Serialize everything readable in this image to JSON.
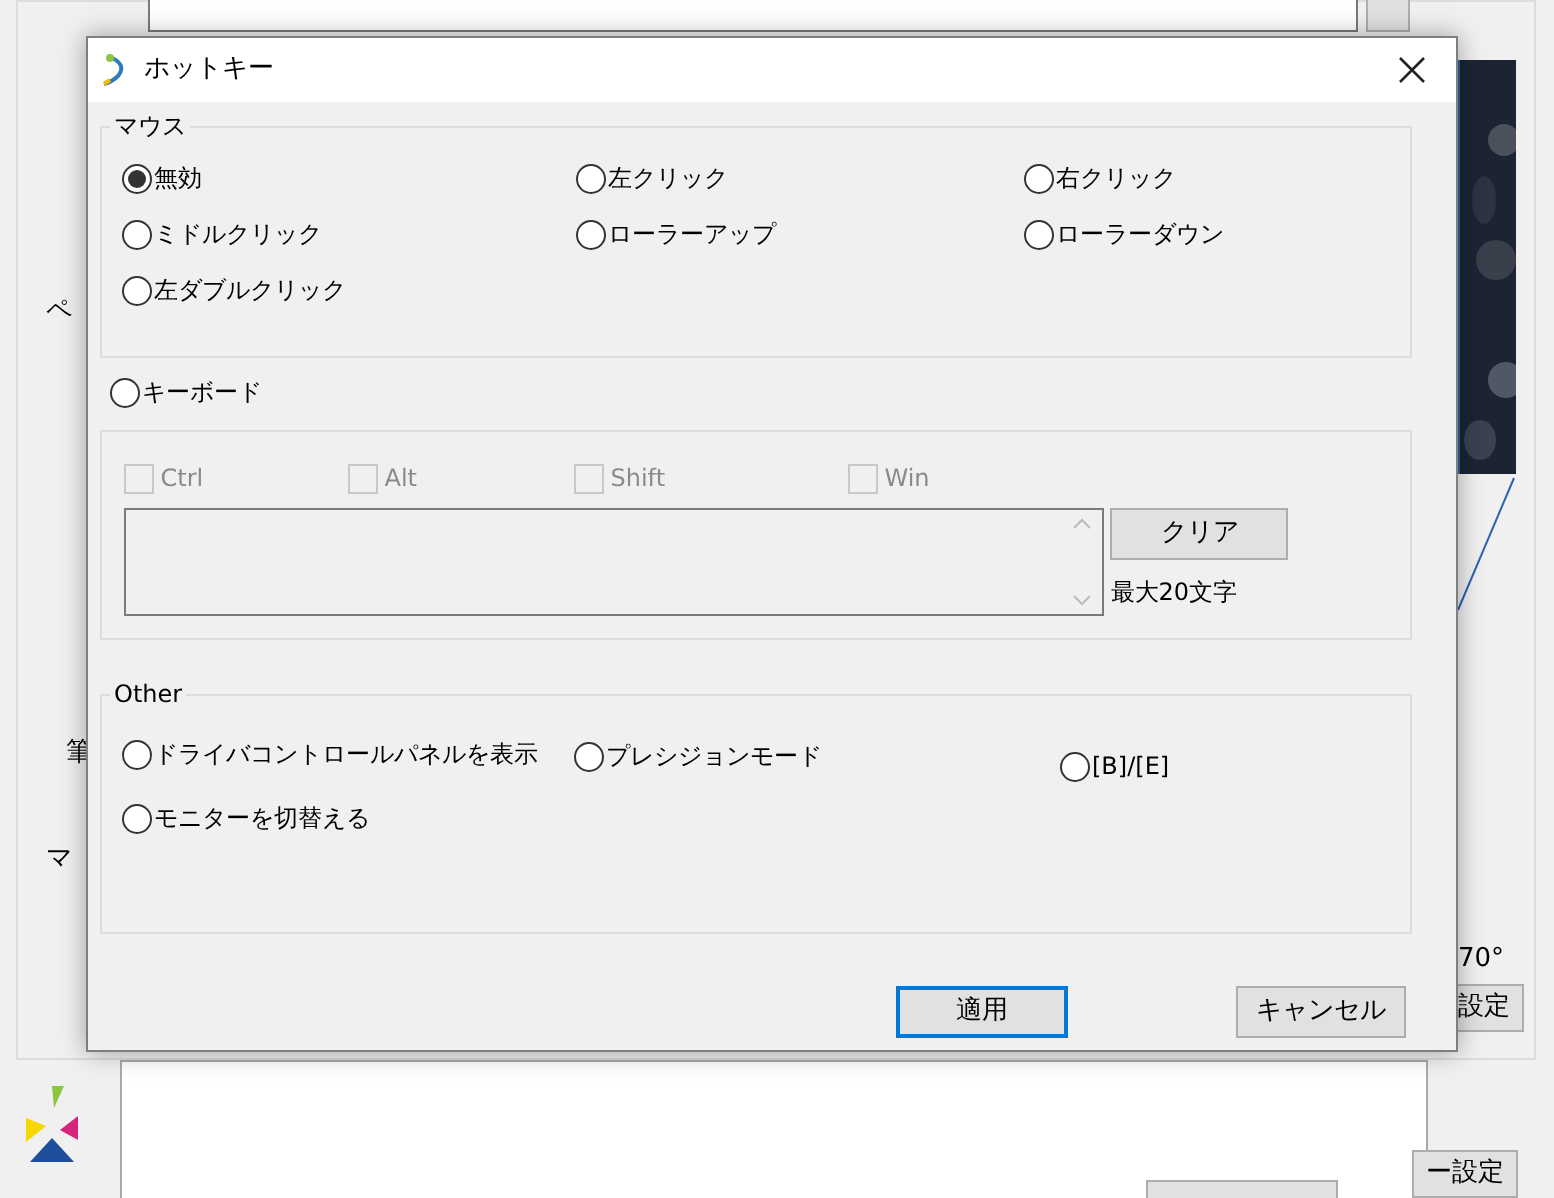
{
  "background": {
    "labels": [
      {
        "text": "ペ",
        "kind": "left"
      },
      {
        "text": "筆",
        "kind": "left"
      },
      {
        "text": "マ",
        "kind": "left"
      },
      {
        "text": "70°",
        "kind": "right"
      }
    ],
    "buttons": [
      "設定",
      "ー設定"
    ]
  },
  "dialog": {
    "title": "ホットキー",
    "mouse": {
      "label": "マウス",
      "options": [
        {
          "label": "無効",
          "selected": true
        },
        {
          "label": "左クリック",
          "selected": false
        },
        {
          "label": "右クリック",
          "selected": false
        },
        {
          "label": "ミドルクリック",
          "selected": false
        },
        {
          "label": "ローラーアップ",
          "selected": false
        },
        {
          "label": "ローラーダウン",
          "selected": false
        },
        {
          "label": "左ダブルクリック",
          "selected": false
        }
      ]
    },
    "keyboard": {
      "label": "キーボード",
      "selected": false,
      "disabled": true,
      "modifiers": [
        {
          "label": "Ctrl",
          "checked": false
        },
        {
          "label": "Alt",
          "checked": false
        },
        {
          "label": "Shift",
          "checked": false
        },
        {
          "label": "Win",
          "checked": false
        }
      ],
      "clear_button": "クリア",
      "max_note": "最大20文字"
    },
    "other": {
      "label": "Other",
      "options": [
        {
          "label": "ドライバコントロールパネルを表示",
          "selected": false
        },
        {
          "label": "プレシジョンモード",
          "selected": false
        },
        {
          "label": "[B]/[E]",
          "selected": false
        },
        {
          "label": "モニターを切替える",
          "selected": false
        }
      ]
    },
    "buttons": [
      {
        "label": "適用",
        "focused": true
      },
      {
        "label": "キャンセル",
        "focused": false
      }
    ]
  }
}
